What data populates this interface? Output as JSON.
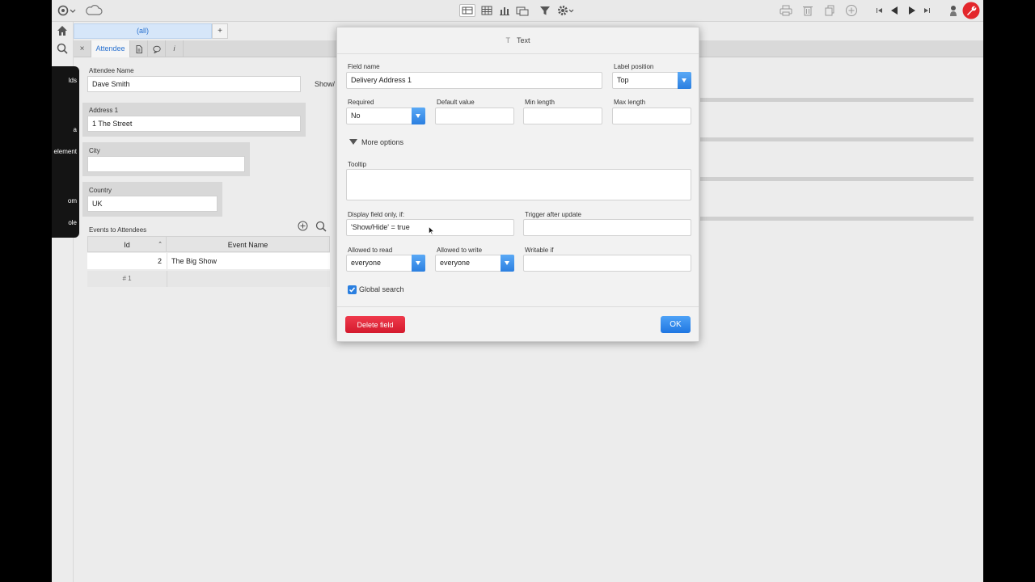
{
  "tabs": {
    "view_tab": "(all)",
    "add_tab": "+",
    "close_glyph": "×",
    "active_tab": "Attendee",
    "info_glyph": "i"
  },
  "sidebar_menu": {
    "items": [
      "lds",
      "a",
      "element",
      "om",
      "ole"
    ]
  },
  "form": {
    "attendee_name": {
      "label": "Attendee Name",
      "value": "Dave Smith"
    },
    "show_hide_label": "Show/",
    "address1": {
      "label": "Address 1",
      "value": "1 The Street"
    },
    "city": {
      "label": "City",
      "value": ""
    },
    "country": {
      "label": "Country",
      "value": "UK"
    }
  },
  "events_table": {
    "title": "Events to Attendees",
    "columns": [
      "Id",
      "Event Name"
    ],
    "rows": [
      {
        "id": "2",
        "event_name": "The Big Show"
      }
    ],
    "new_row": "# 1"
  },
  "modal": {
    "title": "Text",
    "field_name": {
      "label": "Field name",
      "value": "Delivery Address 1"
    },
    "label_position": {
      "label": "Label position",
      "value": "Top"
    },
    "required": {
      "label": "Required",
      "value": "No"
    },
    "default_value": {
      "label": "Default value",
      "value": ""
    },
    "min_length": {
      "label": "Min length",
      "value": ""
    },
    "max_length": {
      "label": "Max length",
      "value": ""
    },
    "more_options": "More options",
    "tooltip": {
      "label": "Tooltip",
      "value": ""
    },
    "display_if": {
      "label": "Display field only, if:",
      "value": "'Show/Hide' = true"
    },
    "trigger_after_update": {
      "label": "Trigger after update",
      "value": ""
    },
    "allowed_to_read": {
      "label": "Allowed to read",
      "value": "everyone"
    },
    "allowed_to_write": {
      "label": "Allowed to write",
      "value": "everyone"
    },
    "writable_if": {
      "label": "Writable if",
      "value": ""
    },
    "global_search": {
      "label": "Global search",
      "checked": true
    },
    "delete_button": "Delete field",
    "ok_button": "OK"
  },
  "colors": {
    "accent": "#2a7fe0",
    "danger": "#d41a2d",
    "active_tab_text": "#2a72d0"
  }
}
